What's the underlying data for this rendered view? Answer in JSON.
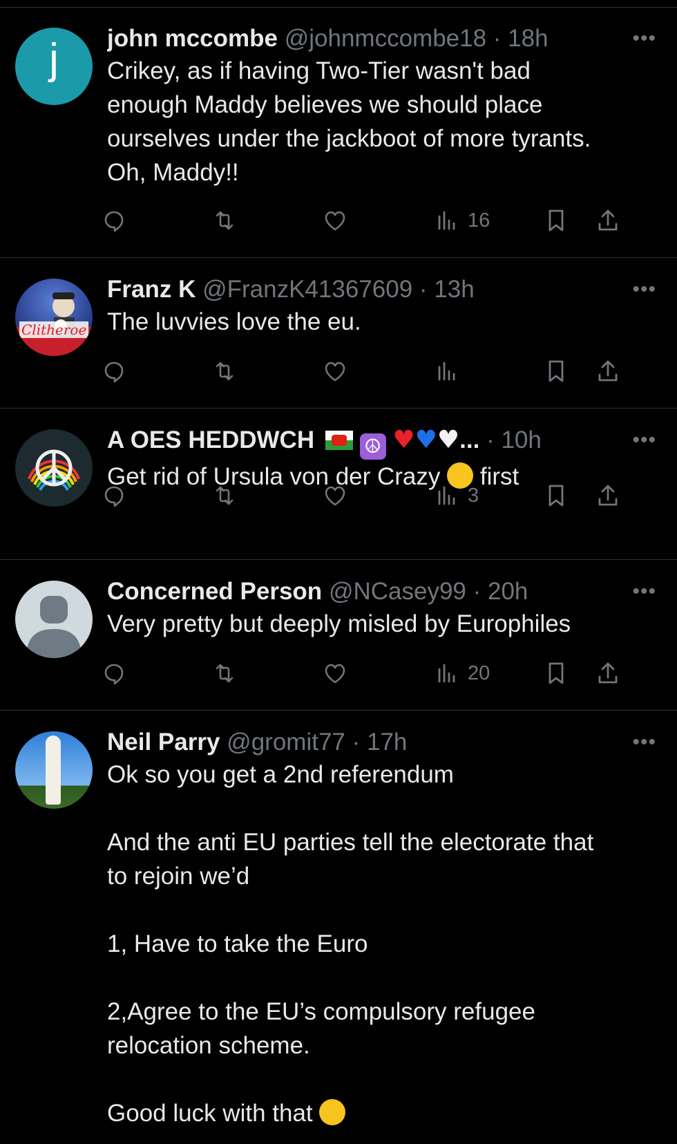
{
  "tweets": [
    {
      "name": "john mccombe",
      "handle": "@johnmccombe18",
      "time": "18h",
      "text": "Crikey, as if having Two-Tier wasn't bad\nenough Maddy believes we should place\nourselves under the jackboot of more tyrants.\nOh, Maddy!!",
      "views": "16",
      "avatar_letter": "j",
      "avatar_color": "#1b9aaa"
    },
    {
      "name": "Franz K",
      "handle": "@FranzK41367609",
      "time": "13h",
      "text": "The luvvies love the eu.",
      "views": "",
      "avatar_text": "Clitheroe"
    },
    {
      "name": "A OES HEDDWCH",
      "name_suffix": "...",
      "handle": "",
      "time": "10h",
      "text_before_emoji": "Get rid of Ursula von der Crazy ",
      "text_after_emoji": " first",
      "views": "3",
      "avatar_text_top": "GIVE PEACE",
      "avatar_text_bottom": "A CHANCE"
    },
    {
      "name": "Concerned Person",
      "handle": "@NCasey99",
      "time": "20h",
      "text": "Very pretty but deeply misled by Europhiles",
      "views": "20"
    },
    {
      "name": "Neil Parry",
      "handle": "@gromit77",
      "time": "17h",
      "text": "Ok so you get a 2nd referendum\n\nAnd the anti EU parties tell the electorate that\nto rejoin we’d\n\n1, Have to take the Euro\n\n2,Agree to the EU’s compulsory refugee\nrelocation scheme.\n\nGood luck with that "
    }
  ],
  "more_glyph": "•••",
  "icons": [
    "reply-icon",
    "retweet-icon",
    "like-icon",
    "views-icon",
    "bookmark-icon",
    "share-icon"
  ],
  "colors": {
    "background": "#000000",
    "text": "#e7e9ea",
    "muted": "#71767b",
    "divider": "#2f3336"
  }
}
